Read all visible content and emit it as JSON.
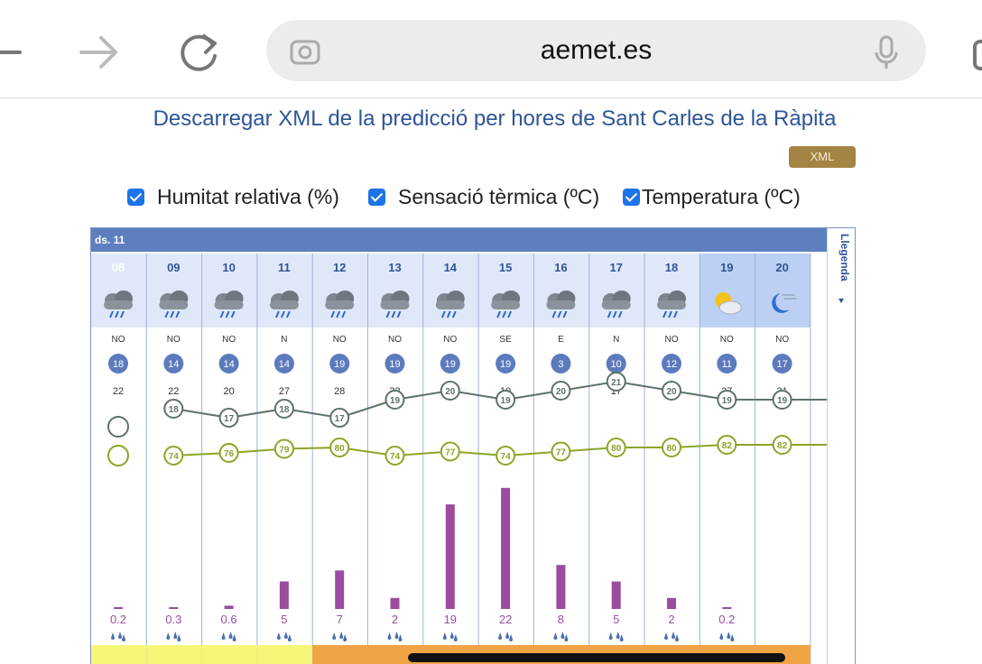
{
  "browser": {
    "url": "aemet.es",
    "icons": [
      "back-arrow-icon",
      "forward-arrow-icon",
      "reload-icon",
      "camera-search-icon",
      "microphone-icon",
      "tabs-icon"
    ]
  },
  "page": {
    "download_link": "Descarregar XML de la predicció per hores de Sant Carles de la Ràpita",
    "xml_badge": "XML",
    "checkboxes": [
      {
        "label": "Humitat relativa (%)",
        "checked": true
      },
      {
        "label": "Sensació tèrmica (ºC)",
        "checked": true
      },
      {
        "label": "Temperatura (ºC)",
        "checked": true
      }
    ]
  },
  "colors": {
    "header_blue": "#5e7fbf",
    "hour_bg": "#dfe8f8",
    "text_blue": "#2e5596",
    "xml_gold": "#a48443",
    "temp_line": "#5e7267",
    "humidity_line": "#8aa626",
    "precip_bar": "#9b4c9f",
    "wind_badge": "#5c7bbd",
    "level_yellow": "#f7f577",
    "level_orange": "#f0a444"
  },
  "forecast": {
    "day_label": "ds. 11",
    "legend_label": "Llegenda",
    "hours": [
      "08",
      "09",
      "10",
      "11",
      "12",
      "13",
      "14",
      "15",
      "16",
      "17",
      "18",
      "19",
      "20"
    ],
    "sky_icons": [
      "rain-cloud-icon",
      "rain-cloud-icon",
      "rain-cloud-icon",
      "rain-cloud-icon",
      "rain-cloud-icon",
      "rain-cloud-icon",
      "rain-cloud-icon",
      "rain-cloud-icon",
      "rain-cloud-icon",
      "rain-cloud-icon",
      "rain-cloud-icon",
      "partly-cloudy-sun-icon",
      "moon-cloud-icon"
    ],
    "wind_dir": [
      "NO",
      "NO",
      "NO",
      "N",
      "NO",
      "NO",
      "NO",
      "SE",
      "E",
      "N",
      "NO",
      "NO",
      "NO"
    ],
    "wind_speed": [
      "18",
      "14",
      "14",
      "14",
      "19",
      "19",
      "19",
      "19",
      "3",
      "10",
      "12",
      "11",
      "17"
    ],
    "wind_gust": [
      "22",
      "22",
      "20",
      "27",
      "28",
      "32",
      "47",
      "10",
      "15",
      "17",
      "18",
      "27",
      "21"
    ],
    "temperature": [
      null,
      18,
      17,
      18,
      17,
      19,
      20,
      19,
      20,
      21,
      20,
      19,
      19
    ],
    "humidity": [
      null,
      74,
      76,
      79,
      80,
      74,
      77,
      74,
      77,
      80,
      80,
      82,
      82
    ],
    "precip": [
      0.2,
      0.3,
      0.6,
      5,
      7,
      2,
      19,
      22,
      8,
      5,
      2,
      0.2,
      null
    ],
    "precip_labels": [
      "0.2",
      "0.3",
      "0.6",
      "5",
      "7",
      "2",
      "19",
      "22",
      "8",
      "5",
      "2",
      "0.2",
      ""
    ],
    "warning_levels": [
      "yellow",
      "yellow",
      "yellow",
      "yellow",
      "orange",
      "orange",
      "orange",
      "orange",
      "orange",
      "orange",
      "orange",
      "orange",
      "orange"
    ]
  }
}
